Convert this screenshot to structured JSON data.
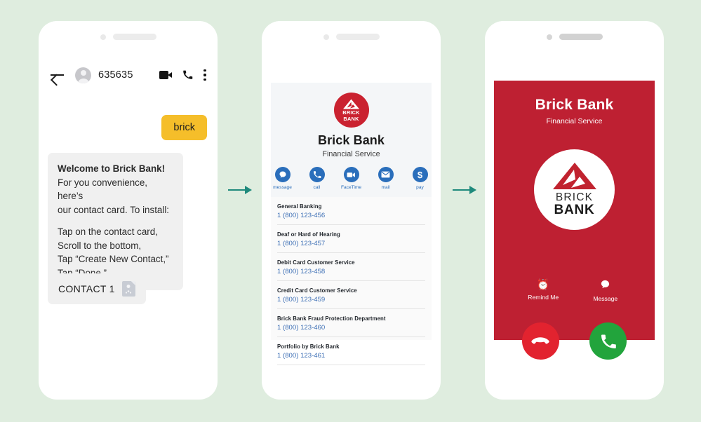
{
  "background_color": "#dfeddf",
  "arrow_color": "#1f8a7c",
  "phone1": {
    "name": "sms-conversation",
    "header": {
      "back_icon": "back-arrow-icon",
      "avatar": "contact-avatar",
      "number": "635635",
      "video_icon": "video-call-icon",
      "call_icon": "phone-call-icon",
      "menu_icon": "overflow-menu-icon"
    },
    "outgoing_message": "brick",
    "outgoing_bubble_color": "#f5be2a",
    "incoming_message": {
      "line1": "Welcome to Brick Bank!",
      "line2": "For you convenience, here’s",
      "line3": "our contact card. To install:",
      "line4": "Tap on the contact card,",
      "line5": "Scroll to the bottom,",
      "line6": "Tap “Create New Contact,”",
      "line7": "Tap “Done.”"
    },
    "attachment": {
      "label": "CONTACT 1",
      "icon": "vcard-icon"
    }
  },
  "phone2": {
    "name": "contact-card",
    "logo_text_line1": "BRICK",
    "logo_text_line2": "BANK",
    "title": "Brick Bank",
    "subtitle": "Financial Service",
    "brand_red": "#ca2230",
    "action_blue": "#2a6ebb",
    "actions": [
      {
        "label": "message",
        "icon": "message-bubble-icon",
        "glyph": "💬"
      },
      {
        "label": "call",
        "icon": "phone-handset-icon",
        "glyph": "✆"
      },
      {
        "label": "FaceTime",
        "icon": "video-camera-icon",
        "glyph": "▶"
      },
      {
        "label": "mail",
        "icon": "envelope-icon",
        "glyph": "✉"
      },
      {
        "label": "pay",
        "icon": "dollar-sign-icon",
        "glyph": "$"
      }
    ],
    "contacts": [
      {
        "title": "General Banking",
        "number": "1 (800) 123-456"
      },
      {
        "title": "Deaf or Hard of Hearing",
        "number": "1 (800) 123-457"
      },
      {
        "title": "Debit Card Customer Service",
        "number": "1 (800) 123-458"
      },
      {
        "title": "Credit Card Customer Service",
        "number": "1 (800) 123-459"
      },
      {
        "title": "Brick Bank Fraud Protection Department",
        "number": "1 (800) 123-460"
      },
      {
        "title": "Portfolio by Brick Bank",
        "number": "1 (800) 123-461"
      }
    ],
    "number_color": "#3d6fb5"
  },
  "phone3": {
    "name": "incoming-call-screen",
    "panel_red": "#be2032",
    "caller_name": "Brick Bank",
    "caller_subtitle": "Financial Service",
    "logo_text_line1": "BRICK",
    "logo_text_line2": "BANK",
    "mini_actions": [
      {
        "label": "Remind Me",
        "icon": "alarm-clock-icon",
        "glyph": "⏰"
      },
      {
        "label": "Message",
        "icon": "message-bubble-icon",
        "glyph": "⬤"
      }
    ],
    "main_actions": [
      {
        "label": "Decline",
        "icon": "decline-call-icon",
        "color": "#e2232f"
      },
      {
        "label": "Accept",
        "icon": "accept-call-icon",
        "color": "#22a43c"
      }
    ]
  }
}
